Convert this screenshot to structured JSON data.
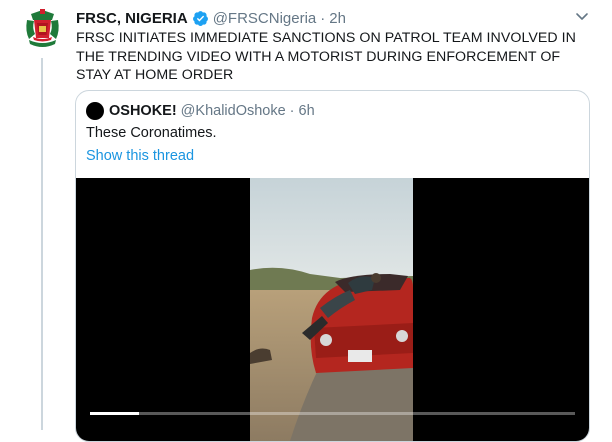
{
  "tweet": {
    "author_name": "FRSC, NIGERIA",
    "handle": "@FRSCNigeria",
    "separator": "·",
    "time": "2h",
    "text": "FRSC  INITIATES IMMEDIATE SANCTIONS ON PATROL TEAM  INVOLVED IN THE TRENDING VIDEO WITH A MOTORIST DURING ENFORCEMENT OF STAY AT HOME ORDER"
  },
  "quoted": {
    "author_name": "OSHOKE!",
    "handle": "@KhalidOshoke",
    "separator": "·",
    "time": "6h",
    "text": "These Coronatimes.",
    "link": "Show this thread"
  },
  "video": {
    "progress": 0.1
  },
  "colors": {
    "verified": "#1da1f2",
    "link": "#1b95e0",
    "secondary_text": "#657786",
    "border": "#ccd6dd"
  },
  "icons": {
    "verified": "verified-badge-icon",
    "caret": "chevron-down-icon"
  }
}
